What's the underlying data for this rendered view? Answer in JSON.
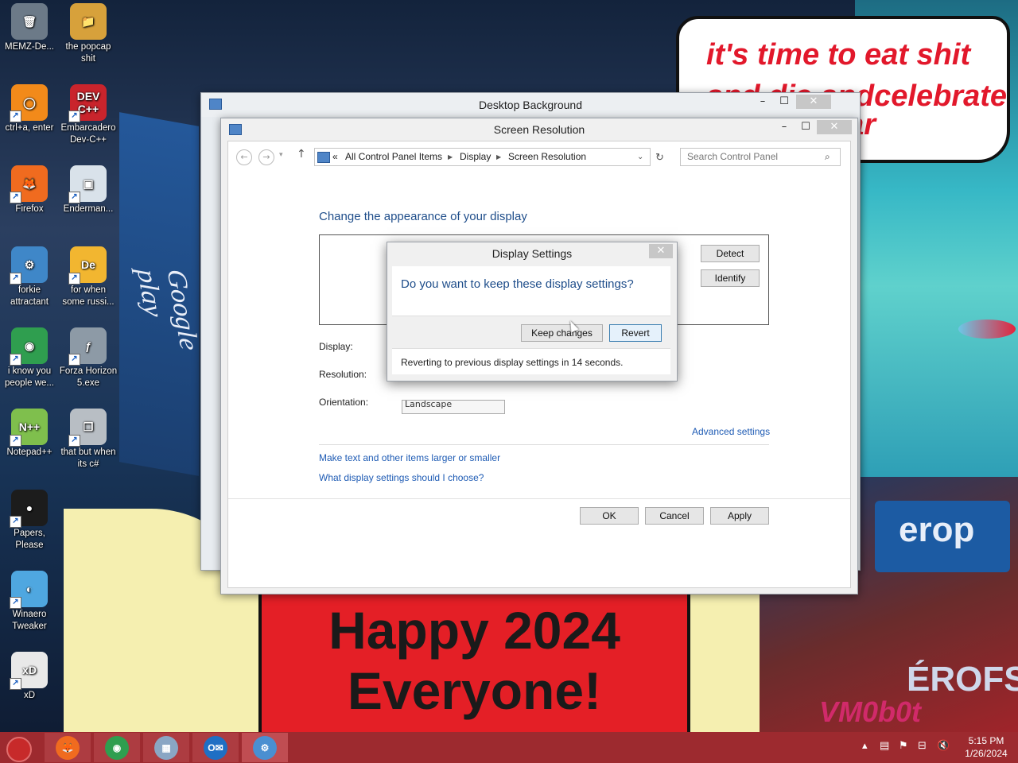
{
  "wallpaper": {
    "bubble_line1": "it's time to eat shit",
    "bubble_line2": "and die andcelebrate",
    "bubble_line3": "ear",
    "banner_line1": "Happy 2024",
    "banner_line2": "Everyone!",
    "sign_text": "erop",
    "sign_text2": "ÉROFS",
    "sign_text3": "VM0b0t",
    "google_play": "Google play"
  },
  "desktop_icons": [
    {
      "label": "MEMZ-De...",
      "icon": "recycle-bin-icon",
      "color": "#6c7a88",
      "glyph": "🗑"
    },
    {
      "label": "the popcap shit",
      "icon": "folder-icon",
      "color": "#d7a13b",
      "glyph": "📁"
    },
    {
      "label": "ctrl+a, enter",
      "icon": "orange-ring-icon",
      "color": "#f28a1a",
      "glyph": "◯"
    },
    {
      "label": "Embarcadero Dev-C++",
      "icon": "devcpp-icon",
      "color": "#c9242c",
      "glyph": "DEV C++"
    },
    {
      "label": "Firefox",
      "icon": "firefox-icon",
      "color": "#f06b1f",
      "glyph": "🦊"
    },
    {
      "label": "Enderman...",
      "icon": "window-icon",
      "color": "#d9e2ea",
      "glyph": "▣"
    },
    {
      "label": "forkie attractant",
      "icon": "settings-monitor-icon",
      "color": "#3f87c8",
      "glyph": "⚙"
    },
    {
      "label": "for when some russi...",
      "icon": "de-icon",
      "color": "#f2b630",
      "glyph": "De"
    },
    {
      "label": "i know you people we...",
      "icon": "chrome-icon",
      "color": "#2f9e4f",
      "glyph": "◉"
    },
    {
      "label": "Forza Horizon 5.exe",
      "icon": "flash-icon",
      "color": "#8d9aa6",
      "glyph": "ƒ"
    },
    {
      "label": "Notepad++",
      "icon": "notepad-icon",
      "color": "#7fbf4d",
      "glyph": "N++"
    },
    {
      "label": "that but when its c#",
      "icon": "stack-icon",
      "color": "#b8bec4",
      "glyph": "❐"
    },
    {
      "label": "Papers, Please",
      "icon": "papers-please-icon",
      "color": "#1c1c1c",
      "glyph": "●"
    },
    {
      "label": "Winaero Tweaker",
      "icon": "winaero-icon",
      "color": "#4fa7e0",
      "glyph": "◐"
    },
    {
      "label": "xD",
      "icon": "xd-icon",
      "color": "#e9e9e9",
      "glyph": "xD"
    }
  ],
  "bg_window": {
    "title": "Desktop Background"
  },
  "main_window": {
    "title": "Screen Resolution",
    "breadcrumb": [
      "All Control Panel Items",
      "Display",
      "Screen Resolution"
    ],
    "breadcrumb_prefix": "«",
    "search_placeholder": "Search Control Panel",
    "heading": "Change the appearance of your display",
    "detect_label": "Detect",
    "identify_label": "Identify",
    "display_label": "Display:",
    "resolution_label": "Resolution:",
    "orientation_label": "Orientation:",
    "orientation_value": "Landscape",
    "advanced_link": "Advanced settings",
    "link1": "Make text and other items larger or smaller",
    "link2": "What display settings should I choose?",
    "ok_label": "OK",
    "cancel_label": "Cancel",
    "apply_label": "Apply"
  },
  "dialog": {
    "title": "Display Settings",
    "question": "Do you want to keep these display settings?",
    "keep_label": "Keep changes",
    "revert_label": "Revert",
    "message": "Reverting to previous display settings in 14 seconds."
  },
  "taskbar": {
    "items": [
      {
        "icon": "firefox-icon",
        "glyph": "🦊",
        "color": "#f06b1f"
      },
      {
        "icon": "chrome-icon",
        "glyph": "◉",
        "color": "#2f9e4f"
      },
      {
        "icon": "picture-viewer-icon",
        "glyph": "▦",
        "color": "#8aa6c4"
      },
      {
        "icon": "outlook-icon",
        "glyph": "O✉",
        "color": "#1f6fc4"
      },
      {
        "icon": "control-panel-icon",
        "glyph": "⚙",
        "color": "#4a8fd1"
      }
    ],
    "time": "5:15 PM",
    "date": "1/26/2024"
  }
}
